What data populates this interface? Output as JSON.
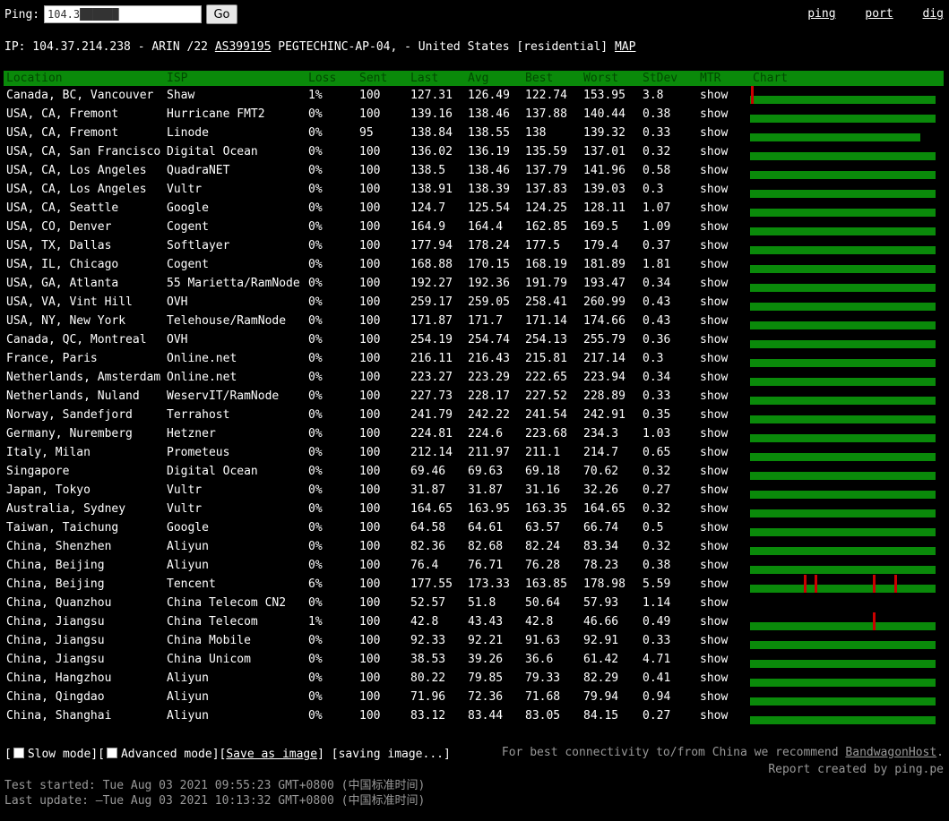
{
  "topbar": {
    "ping_label": "Ping:",
    "ping_value": "104.3██████",
    "go_label": "Go",
    "links": [
      "ping",
      "port",
      "dig"
    ]
  },
  "ipinfo": {
    "prefix": "IP: 104.37.214.238 - ARIN /22 ",
    "asn": "AS399195",
    "suffix": " PEGTECHINC-AP-04, - United States [residential] ",
    "map": "MAP"
  },
  "columns": [
    "Location",
    "ISP",
    "Loss",
    "Sent",
    "Last",
    "Avg",
    "Best",
    "Worst",
    "StDev",
    "MTR",
    "Chart"
  ],
  "mtr_label": "show",
  "rows": [
    {
      "location": "Canada, BC, Vancouver",
      "isp": "Shaw",
      "loss": "1%",
      "sent": "100",
      "last": "127.31",
      "avg": "126.49",
      "best": "122.74",
      "worst": "153.95",
      "stdev": "3.8",
      "chart": {
        "fill": 1.0,
        "spikes": [
          0.003
        ]
      }
    },
    {
      "location": "USA, CA, Fremont",
      "isp": "Hurricane FMT2",
      "loss": "0%",
      "sent": "100",
      "last": "139.16",
      "avg": "138.46",
      "best": "137.88",
      "worst": "140.44",
      "stdev": "0.38",
      "chart": {
        "fill": 1.0,
        "spikes": []
      }
    },
    {
      "location": "USA, CA, Fremont",
      "isp": "Linode",
      "loss": "0%",
      "sent": "95",
      "last": "138.84",
      "avg": "138.55",
      "best": "138",
      "worst": "139.32",
      "stdev": "0.33",
      "chart": {
        "fill": 0.92,
        "spikes": []
      }
    },
    {
      "location": "USA, CA, San Francisco",
      "isp": "Digital Ocean",
      "loss": "0%",
      "sent": "100",
      "last": "136.02",
      "avg": "136.19",
      "best": "135.59",
      "worst": "137.01",
      "stdev": "0.32",
      "chart": {
        "fill": 1.0,
        "spikes": []
      }
    },
    {
      "location": "USA, CA, Los Angeles",
      "isp": "QuadraNET",
      "loss": "0%",
      "sent": "100",
      "last": "138.5",
      "avg": "138.46",
      "best": "137.79",
      "worst": "141.96",
      "stdev": "0.58",
      "chart": {
        "fill": 1.0,
        "spikes": []
      }
    },
    {
      "location": "USA, CA, Los Angeles",
      "isp": "Vultr",
      "loss": "0%",
      "sent": "100",
      "last": "138.91",
      "avg": "138.39",
      "best": "137.83",
      "worst": "139.03",
      "stdev": "0.3",
      "chart": {
        "fill": 1.0,
        "spikes": []
      }
    },
    {
      "location": "USA, CA, Seattle",
      "isp": "Google",
      "loss": "0%",
      "sent": "100",
      "last": "124.7",
      "avg": "125.54",
      "best": "124.25",
      "worst": "128.11",
      "stdev": "1.07",
      "chart": {
        "fill": 1.0,
        "spikes": []
      }
    },
    {
      "location": "USA, CO, Denver",
      "isp": "Cogent",
      "loss": "0%",
      "sent": "100",
      "last": "164.9",
      "avg": "164.4",
      "best": "162.85",
      "worst": "169.5",
      "stdev": "1.09",
      "chart": {
        "fill": 1.0,
        "spikes": []
      }
    },
    {
      "location": "USA, TX, Dallas",
      "isp": "Softlayer",
      "loss": "0%",
      "sent": "100",
      "last": "177.94",
      "avg": "178.24",
      "best": "177.5",
      "worst": "179.4",
      "stdev": "0.37",
      "chart": {
        "fill": 1.0,
        "spikes": []
      }
    },
    {
      "location": "USA, IL, Chicago",
      "isp": "Cogent",
      "loss": "0%",
      "sent": "100",
      "last": "168.88",
      "avg": "170.15",
      "best": "168.19",
      "worst": "181.89",
      "stdev": "1.81",
      "chart": {
        "fill": 1.0,
        "spikes": []
      }
    },
    {
      "location": "USA, GA, Atlanta",
      "isp": "55 Marietta/RamNode",
      "loss": "0%",
      "sent": "100",
      "last": "192.27",
      "avg": "192.36",
      "best": "191.79",
      "worst": "193.47",
      "stdev": "0.34",
      "chart": {
        "fill": 1.0,
        "spikes": []
      }
    },
    {
      "location": "USA, VA, Vint Hill",
      "isp": "OVH",
      "loss": "0%",
      "sent": "100",
      "last": "259.17",
      "avg": "259.05",
      "best": "258.41",
      "worst": "260.99",
      "stdev": "0.43",
      "chart": {
        "fill": 1.0,
        "spikes": []
      }
    },
    {
      "location": "USA, NY, New York",
      "isp": "Telehouse/RamNode",
      "loss": "0%",
      "sent": "100",
      "last": "171.87",
      "avg": "171.7",
      "best": "171.14",
      "worst": "174.66",
      "stdev": "0.43",
      "chart": {
        "fill": 1.0,
        "spikes": []
      }
    },
    {
      "location": "Canada, QC, Montreal",
      "isp": "OVH",
      "loss": "0%",
      "sent": "100",
      "last": "254.19",
      "avg": "254.74",
      "best": "254.13",
      "worst": "255.79",
      "stdev": "0.36",
      "chart": {
        "fill": 1.0,
        "spikes": []
      }
    },
    {
      "location": "France, Paris",
      "isp": "Online.net",
      "loss": "0%",
      "sent": "100",
      "last": "216.11",
      "avg": "216.43",
      "best": "215.81",
      "worst": "217.14",
      "stdev": "0.3",
      "chart": {
        "fill": 1.0,
        "spikes": []
      }
    },
    {
      "location": "Netherlands, Amsterdam",
      "isp": "Online.net",
      "loss": "0%",
      "sent": "100",
      "last": "223.27",
      "avg": "223.29",
      "best": "222.65",
      "worst": "223.94",
      "stdev": "0.34",
      "chart": {
        "fill": 1.0,
        "spikes": []
      }
    },
    {
      "location": "Netherlands, Nuland",
      "isp": "WeservIT/RamNode",
      "loss": "0%",
      "sent": "100",
      "last": "227.73",
      "avg": "228.17",
      "best": "227.52",
      "worst": "228.89",
      "stdev": "0.33",
      "chart": {
        "fill": 1.0,
        "spikes": []
      }
    },
    {
      "location": "Norway, Sandefjord",
      "isp": "Terrahost",
      "loss": "0%",
      "sent": "100",
      "last": "241.79",
      "avg": "242.22",
      "best": "241.54",
      "worst": "242.91",
      "stdev": "0.35",
      "chart": {
        "fill": 1.0,
        "spikes": []
      }
    },
    {
      "location": "Germany, Nuremberg",
      "isp": "Hetzner",
      "loss": "0%",
      "sent": "100",
      "last": "224.81",
      "avg": "224.6",
      "best": "223.68",
      "worst": "234.3",
      "stdev": "1.03",
      "chart": {
        "fill": 1.0,
        "spikes": []
      }
    },
    {
      "location": "Italy, Milan",
      "isp": "Prometeus",
      "loss": "0%",
      "sent": "100",
      "last": "212.14",
      "avg": "211.97",
      "best": "211.1",
      "worst": "214.7",
      "stdev": "0.65",
      "chart": {
        "fill": 1.0,
        "spikes": []
      }
    },
    {
      "location": "Singapore",
      "isp": "Digital Ocean",
      "loss": "0%",
      "sent": "100",
      "last": "69.46",
      "avg": "69.63",
      "best": "69.18",
      "worst": "70.62",
      "stdev": "0.32",
      "chart": {
        "fill": 1.0,
        "spikes": []
      }
    },
    {
      "location": "Japan, Tokyo",
      "isp": "Vultr",
      "loss": "0%",
      "sent": "100",
      "last": "31.87",
      "avg": "31.87",
      "best": "31.16",
      "worst": "32.26",
      "stdev": "0.27",
      "chart": {
        "fill": 1.0,
        "spikes": []
      }
    },
    {
      "location": "Australia, Sydney",
      "isp": "Vultr",
      "loss": "0%",
      "sent": "100",
      "last": "164.65",
      "avg": "163.95",
      "best": "163.35",
      "worst": "164.65",
      "stdev": "0.32",
      "chart": {
        "fill": 1.0,
        "spikes": []
      }
    },
    {
      "location": "Taiwan, Taichung",
      "isp": "Google",
      "loss": "0%",
      "sent": "100",
      "last": "64.58",
      "avg": "64.61",
      "best": "63.57",
      "worst": "66.74",
      "stdev": "0.5",
      "chart": {
        "fill": 1.0,
        "spikes": []
      }
    },
    {
      "location": "China, Shenzhen",
      "isp": "Aliyun",
      "loss": "0%",
      "sent": "100",
      "last": "82.36",
      "avg": "82.68",
      "best": "82.24",
      "worst": "83.34",
      "stdev": "0.32",
      "chart": {
        "fill": 1.0,
        "spikes": []
      }
    },
    {
      "location": "China, Beijing",
      "isp": "Aliyun",
      "loss": "0%",
      "sent": "100",
      "last": "76.4",
      "avg": "76.71",
      "best": "76.28",
      "worst": "78.23",
      "stdev": "0.38",
      "chart": {
        "fill": 1.0,
        "spikes": []
      }
    },
    {
      "location": "China, Beijing",
      "isp": "Tencent",
      "loss": "6%",
      "sent": "100",
      "last": "177.55",
      "avg": "173.33",
      "best": "163.85",
      "worst": "178.98",
      "stdev": "5.59",
      "chart": {
        "fill": 1.0,
        "spikes": [
          0.29,
          0.35,
          0.66,
          0.78
        ]
      }
    },
    {
      "location": "China, Quanzhou",
      "isp": "China Telecom CN2",
      "loss": "0%",
      "sent": "100",
      "last": "52.57",
      "avg": "51.8",
      "best": "50.64",
      "worst": "57.93",
      "stdev": "1.14",
      "chart": {
        "fill": 0,
        "spikes": []
      }
    },
    {
      "location": "China, Jiangsu",
      "isp": "China Telecom",
      "loss": "1%",
      "sent": "100",
      "last": "42.8",
      "avg": "43.43",
      "best": "42.8",
      "worst": "46.66",
      "stdev": "0.49",
      "chart": {
        "fill": 1.0,
        "spikes": [
          0.66
        ]
      }
    },
    {
      "location": "China, Jiangsu",
      "isp": "China Mobile",
      "loss": "0%",
      "sent": "100",
      "last": "92.33",
      "avg": "92.21",
      "best": "91.63",
      "worst": "92.91",
      "stdev": "0.33",
      "chart": {
        "fill": 1.0,
        "spikes": []
      }
    },
    {
      "location": "China, Jiangsu",
      "isp": "China Unicom",
      "loss": "0%",
      "sent": "100",
      "last": "38.53",
      "avg": "39.26",
      "best": "36.6",
      "worst": "61.42",
      "stdev": "4.71",
      "chart": {
        "fill": 1.0,
        "spikes": []
      }
    },
    {
      "location": "China, Hangzhou",
      "isp": "Aliyun",
      "loss": "0%",
      "sent": "100",
      "last": "80.22",
      "avg": "79.85",
      "best": "79.33",
      "worst": "82.29",
      "stdev": "0.41",
      "chart": {
        "fill": 1.0,
        "spikes": []
      }
    },
    {
      "location": "China, Qingdao",
      "isp": "Aliyun",
      "loss": "0%",
      "sent": "100",
      "last": "71.96",
      "avg": "72.36",
      "best": "71.68",
      "worst": "79.94",
      "stdev": "0.94",
      "chart": {
        "fill": 1.0,
        "spikes": []
      }
    },
    {
      "location": "China, Shanghai",
      "isp": "Aliyun",
      "loss": "0%",
      "sent": "100",
      "last": "83.12",
      "avg": "83.44",
      "best": "83.05",
      "worst": "84.15",
      "stdev": "0.27",
      "chart": {
        "fill": 1.0,
        "spikes": []
      }
    }
  ],
  "options": {
    "open": "[",
    "slow_mode": "Slow mode",
    "mid": "][",
    "advanced_mode": "Advanced mode",
    "mid2": "][",
    "save": "Save as image",
    "close": "]",
    "saving": "[saving image...]"
  },
  "footer": {
    "recommend_prefix": "For best connectivity to/from China we recommend ",
    "recommend_link": "BandwagonHost",
    "recommend_suffix": ".",
    "report": "Report created by ping.pe",
    "test_started": "Test started: Tue Aug 03 2021 09:55:23 GMT+0800 (中国标准时间)",
    "last_update": "Last update: —Tue Aug 03 2021 10:13:32 GMT+0800 (中国标准时间)"
  },
  "colors": {
    "header_bg": "#0a8a0a",
    "bar": "#0a8a0a",
    "spike": "#cc0000",
    "show_link": "#22cc22",
    "bad_value": "#ff8080"
  }
}
